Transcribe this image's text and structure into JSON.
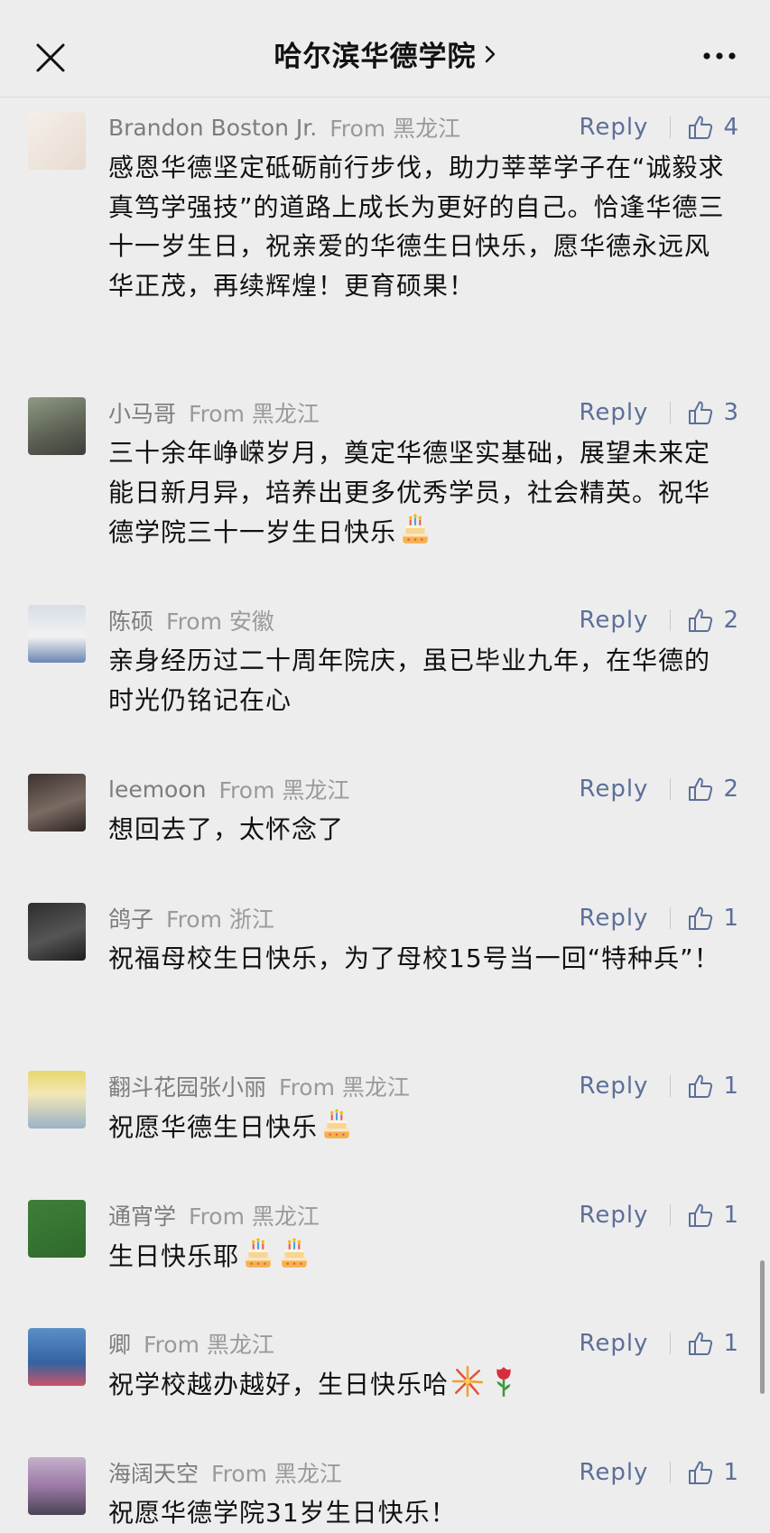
{
  "header": {
    "title": "哈尔滨华德学院",
    "title_arrow": "›"
  },
  "comments": [
    {
      "name": "Brandon Boston Jr.",
      "from": "From 黑龙江",
      "reply": "Reply",
      "likes": "4",
      "text": "感恩华德坚定砥砺前行步伐，助力莘莘学子在“诚毅求真笃学强技”的道路上成长为更好的自己。恰逢华德三十一岁生日，祝亲爱的华德生日快乐，愿华德永远风华正茂，再续辉煌！更育硕果！",
      "emojis": []
    },
    {
      "name": "小马哥",
      "from": "From 黑龙江",
      "reply": "Reply",
      "likes": "3",
      "text": "三十余年峥嵘岁月，奠定华德坚实基础，展望未来定能日新月异，培养出更多优秀学员，社会精英。祝华德学院三十一岁生日快乐",
      "emojis": [
        "cake"
      ]
    },
    {
      "name": "陈硕",
      "from": "From 安徽",
      "reply": "Reply",
      "likes": "2",
      "text": "亲身经历过二十周年院庆，虽已毕业九年，在华德的时光仍铭记在心",
      "emojis": []
    },
    {
      "name": "leemoon",
      "from": "From 黑龙江",
      "reply": "Reply",
      "likes": "2",
      "text": "想回去了，太怀念了",
      "emojis": []
    },
    {
      "name": "鸽子",
      "from": "From 浙江",
      "reply": "Reply",
      "likes": "1",
      "text": "祝福母校生日快乐，为了母校15号当一回“特种兵”！",
      "emojis": []
    },
    {
      "name": "翻斗花园张小丽",
      "from": "From 黑龙江",
      "reply": "Reply",
      "likes": "1",
      "text": "祝愿华德生日快乐",
      "emojis": [
        "cake"
      ]
    },
    {
      "name": "通宵学",
      "from": "From 黑龙江",
      "reply": "Reply",
      "likes": "1",
      "text": "生日快乐耶",
      "emojis": [
        "cake",
        "cake"
      ]
    },
    {
      "name": "卿",
      "from": "From 黑龙江",
      "reply": "Reply",
      "likes": "1",
      "text": "祝学校越办越好，生日快乐哈",
      "emojis": [
        "firework",
        "rose"
      ]
    },
    {
      "name": "海阔天空",
      "from": "From 黑龙江",
      "reply": "Reply",
      "likes": "1",
      "text": "祝愿华德学院31岁生日快乐！",
      "emojis": []
    }
  ],
  "icons": {
    "close": "close-icon",
    "more": "more-icon",
    "like": "thumbs-up-icon",
    "cake": "birthday-cake-emoji",
    "firework": "firework-emoji",
    "rose": "rose-emoji"
  },
  "colors": {
    "background": "#ededed",
    "link_blue": "#5c6f99",
    "meta_gray": "#7d7d7d"
  }
}
